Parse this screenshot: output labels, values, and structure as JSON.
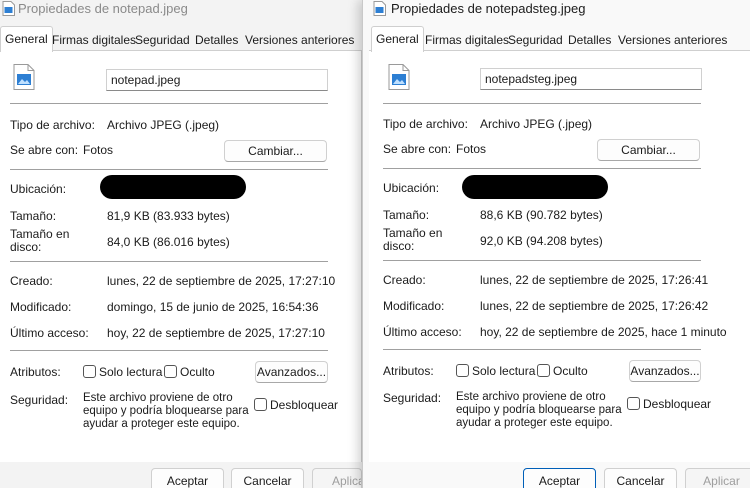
{
  "left": {
    "title": "Propiedades de notepad.jpeg",
    "tabs": [
      "General",
      "Firmas digitales",
      "Seguridad",
      "Detalles",
      "Versiones anteriores"
    ],
    "filename": "notepad.jpeg",
    "type_label": "Tipo de archivo:",
    "type_value": "Archivo JPEG (.jpeg)",
    "opens_label": "Se abre con:",
    "opens_value": "Fotos",
    "change_btn": "Cambiar...",
    "location_label": "Ubicación:",
    "size_label": "Tamaño:",
    "size_value": "81,9 KB (83.933 bytes)",
    "disk_label": "Tamaño en disco:",
    "disk_value": "84,0 KB (86.016 bytes)",
    "created_label": "Creado:",
    "created_value": "lunes, 22 de septiembre de 2025, 17:27:10",
    "modified_label": "Modificado:",
    "modified_value": "domingo, 15 de junio de 2025, 16:54:36",
    "accessed_label": "Último acceso:",
    "accessed_value": "hoy, 22 de septiembre de 2025, 17:27:10",
    "attributes_label": "Atributos:",
    "readonly_label": "Solo lectura",
    "hidden_label": "Oculto",
    "advanced_btn": "Avanzados...",
    "security_label": "Seguridad:",
    "security_text": "Este archivo proviene de otro equipo y podría bloquearse para ayudar a proteger este equipo.",
    "unblock_label": "Desbloquear",
    "ok_btn": "Aceptar",
    "cancel_btn": "Cancelar",
    "apply_btn": "Aplicar"
  },
  "right": {
    "title": "Propiedades de notepadsteg.jpeg",
    "tabs": [
      "General",
      "Firmas digitales",
      "Seguridad",
      "Detalles",
      "Versiones anteriores"
    ],
    "filename": "notepadsteg.jpeg",
    "type_label": "Tipo de archivo:",
    "type_value": "Archivo JPEG (.jpeg)",
    "opens_label": "Se abre con:",
    "opens_value": "Fotos",
    "change_btn": "Cambiar...",
    "location_label": "Ubicación:",
    "size_label": "Tamaño:",
    "size_value": "88,6 KB (90.782 bytes)",
    "disk_label": "Tamaño en disco:",
    "disk_value": "92,0 KB (94.208 bytes)",
    "created_label": "Creado:",
    "created_value": "lunes, 22 de septiembre de 2025, 17:26:41",
    "modified_label": "Modificado:",
    "modified_value": "lunes, 22 de septiembre de 2025, 17:26:42",
    "accessed_label": "Último acceso:",
    "accessed_value": "hoy, 22 de septiembre de 2025, hace 1 minuto",
    "attributes_label": "Atributos:",
    "readonly_label": "Solo lectura",
    "hidden_label": "Oculto",
    "advanced_btn": "Avanzados...",
    "security_label": "Seguridad:",
    "security_text": "Este archivo proviene de otro equipo y podría bloquearse para ayudar a proteger este equipo.",
    "unblock_label": "Desbloquear",
    "ok_btn": "Aceptar",
    "cancel_btn": "Cancelar",
    "apply_btn": "Aplicar"
  },
  "icons": {
    "title": "jpeg-file-icon",
    "file": "jpeg-file-icon",
    "location": "redacted-path"
  },
  "colors": {
    "accent": "#005fb8",
    "background": "#f3f3f3",
    "panel": "#ffffff"
  }
}
